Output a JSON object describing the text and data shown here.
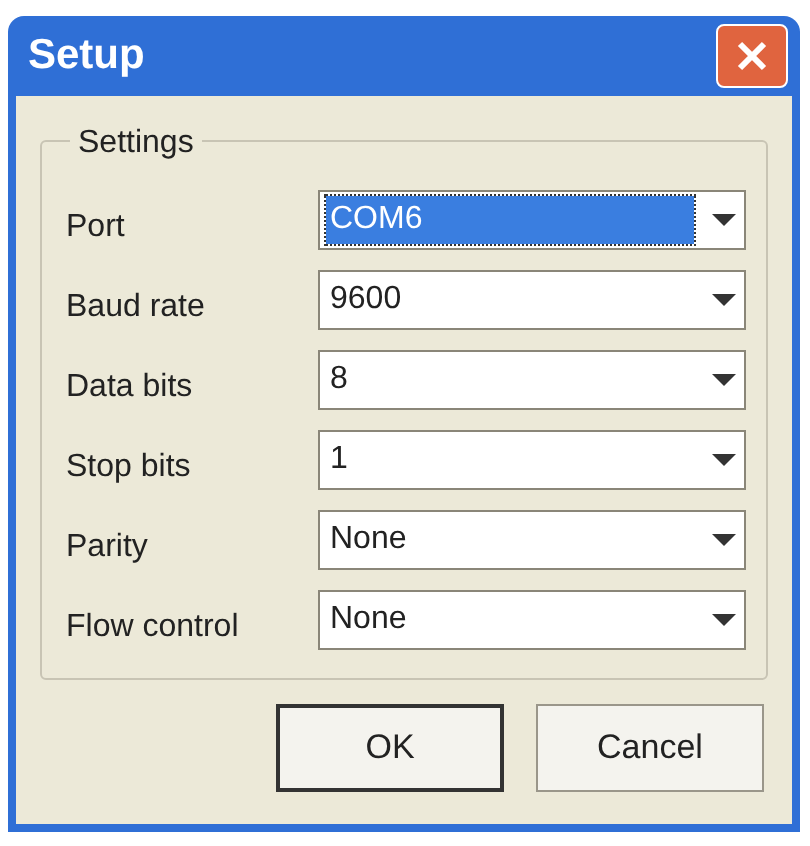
{
  "window": {
    "title": "Setup"
  },
  "group": {
    "title": "Settings"
  },
  "fields": [
    {
      "label": "Port",
      "value": "COM6",
      "selected": true
    },
    {
      "label": "Baud rate",
      "value": "9600",
      "selected": false
    },
    {
      "label": "Data bits",
      "value": "8",
      "selected": false
    },
    {
      "label": "Stop bits",
      "value": "1",
      "selected": false
    },
    {
      "label": "Parity",
      "value": "None",
      "selected": false
    },
    {
      "label": "Flow control",
      "value": "None",
      "selected": false
    }
  ],
  "buttons": [
    {
      "label": "OK",
      "default": true
    },
    {
      "label": "Cancel",
      "default": false
    }
  ]
}
